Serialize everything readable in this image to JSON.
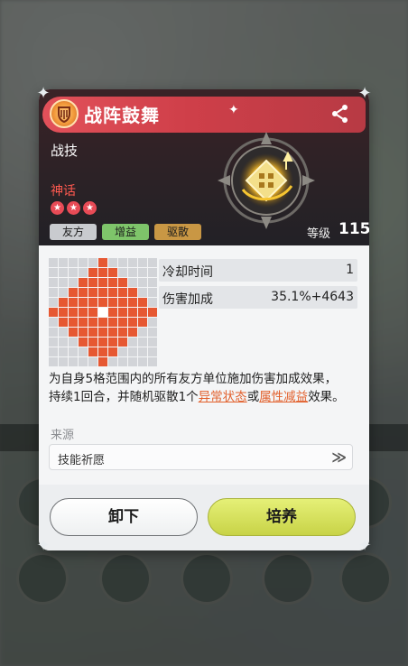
{
  "skill": {
    "name": "战阵鼓舞",
    "type": "战技",
    "rarity": "神话",
    "stars": 3,
    "tags": [
      "友方",
      "增益",
      "驱散"
    ],
    "level_label": "等级",
    "level_value": "115",
    "emblem_icon": "shield-emblem-icon",
    "skill_icon": "boost-compass-icon"
  },
  "stats": [
    {
      "label": "冷却时间",
      "value": "1"
    },
    {
      "label": "伤害加成",
      "value": "35.1%+4643"
    }
  ],
  "range": {
    "size": 11,
    "radius": 5
  },
  "description": {
    "line1": "为自身5格范围内的所有友方单位施加伤害加成效果，",
    "line2_a": "持续1回合，并随机驱散1个",
    "kw1": "异常状态",
    "line2_b": "或",
    "kw2": "属性减益",
    "line2_c": "效果。"
  },
  "source": {
    "label": "来源",
    "value": "技能祈愿"
  },
  "buttons": {
    "unequip": "卸下",
    "cultivate": "培养"
  },
  "colors": {
    "title_red": "#d9434d",
    "range_orange": "#e65832",
    "keyword_orange": "#e2602c",
    "cultivate_yellow": "#d9e35c"
  }
}
